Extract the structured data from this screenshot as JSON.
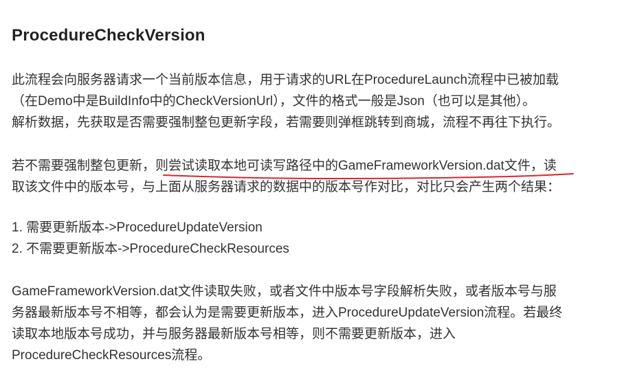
{
  "heading": "ProcedureCheckVersion",
  "para1": {
    "line1": "此流程会向服务器请求一个当前版本信息，用于请求的URL在ProcedureLaunch流程中已被加载",
    "line2": "（在Demo中是BuildInfo中的CheckVersionUrl），文件的格式一般是Json（也可以是其他）。",
    "line3": "解析数据，先获取是否需要强制整包更新字段，若需要则弹框跳转到商城，流程不再往下执行。"
  },
  "para2": {
    "line1_before": "若不需要强制整包更新，",
    "line1_highlight": "则尝试读取本地可读写路径中的GameFrameworkVersion.dat文件",
    "line1_after": "，读",
    "line2": "取该文件中的版本号，与上面从服务器请求的数据中的版本号作对比，对比只会产生两个结果："
  },
  "list": {
    "item1": "1. 需要更新版本->ProcedureUpdateVersion",
    "item2": "2. 不需要更新版本->ProcedureCheckResources"
  },
  "para3": {
    "line1": "GameFrameworkVersion.dat文件读取失败，或者文件中版本号字段解析失败，或者版本号与服",
    "line2": "务器最新版本号不相等，都会认为是需要更新版本，进入ProcedureUpdateVersion流程。若最终",
    "line3": "读取本地版本号成功，并与服务器最新版本号相等，则不需要更新版本，进入",
    "line4": "ProcedureCheckResources流程。"
  },
  "colors": {
    "text": "#333333",
    "heading": "#222222",
    "annotation_underline": "#d9262a"
  }
}
